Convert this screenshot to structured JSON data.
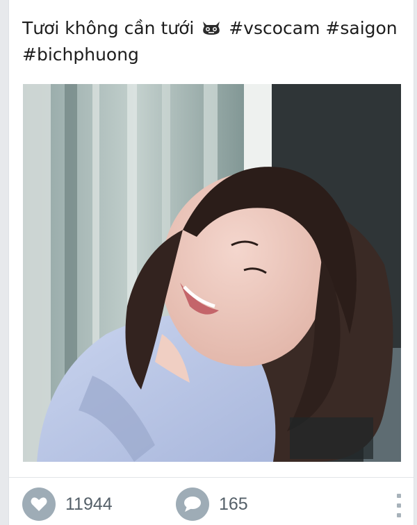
{
  "post": {
    "caption_text": "Tươi không cần tưới",
    "caption_tags": "#vscocam #saigon",
    "caption_tags_line2": "#bichphuong",
    "emoji_icon": "alien-face-icon",
    "photo_icon": "selfie-photo"
  },
  "actions": {
    "likes_count": "11944",
    "comments_count": "165",
    "like_icon": "heart-icon",
    "comment_icon": "speech-bubble-icon",
    "more_icon": "vertical-dots-icon"
  },
  "colors": {
    "icon_circle": "#9eacb6",
    "count_text": "#556069",
    "caption_text": "#1d1d1d",
    "background": "#e7e9ec"
  }
}
